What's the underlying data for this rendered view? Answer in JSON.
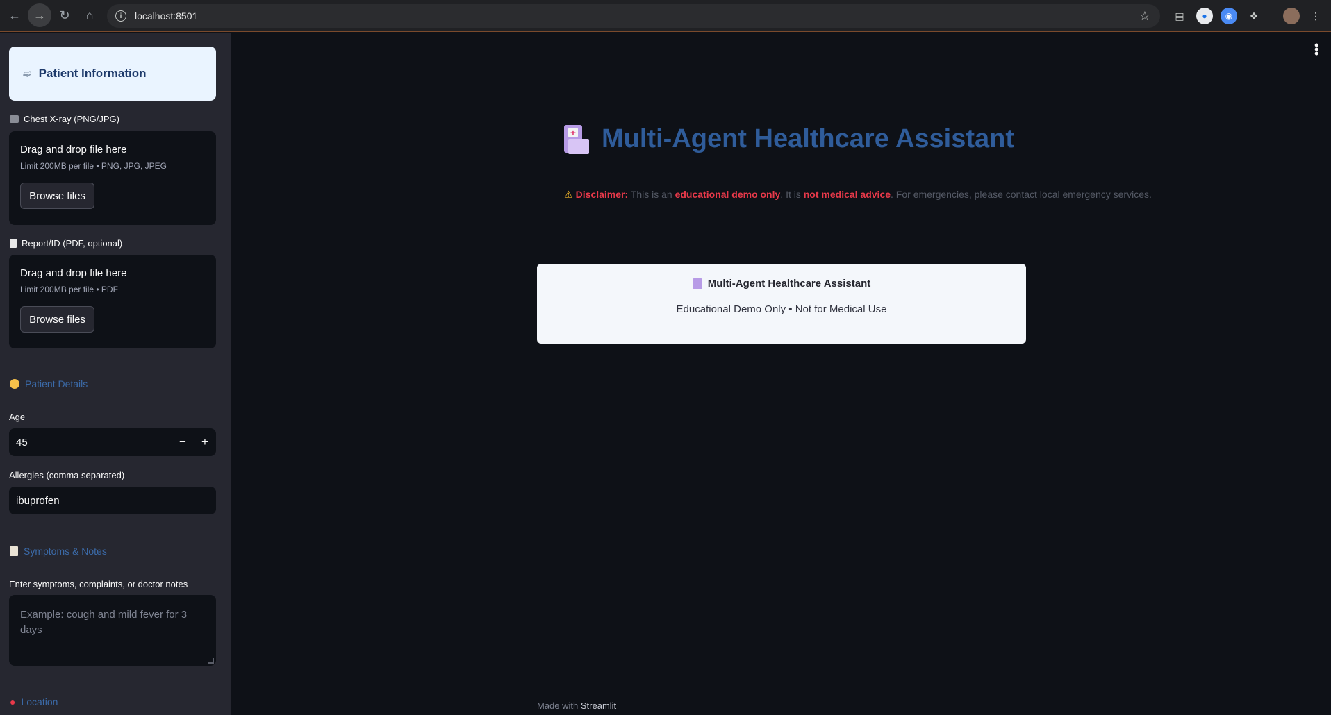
{
  "browser": {
    "url": "localhost:8501"
  },
  "sidebar": {
    "patient_card_title": "Patient Information",
    "chest_xray": {
      "label": "Chest X-ray (PNG/JPG)",
      "dropzone_title": "Drag and drop file here",
      "dropzone_limit": "Limit 200MB per file • PNG, JPG, JPEG",
      "button": "Browse files"
    },
    "report": {
      "label": "Report/ID (PDF, optional)",
      "dropzone_title": "Drag and drop file here",
      "dropzone_limit": "Limit 200MB per file • PDF",
      "button": "Browse files"
    },
    "patient_details": {
      "heading": "Patient Details",
      "age_label": "Age",
      "age_value": "45",
      "decrement": "−",
      "increment": "+",
      "allergies_label": "Allergies (comma separated)",
      "allergies_value": "ibuprofen"
    },
    "symptoms": {
      "heading": "Symptoms & Notes",
      "field_label": "Enter symptoms, complaints, or doctor notes",
      "placeholder": "Example: cough and mild fever for 3 days"
    },
    "location": {
      "heading": "Location"
    }
  },
  "main": {
    "title": "Multi-Agent Healthcare Assistant",
    "disclaimer": {
      "label": "Disclaimer:",
      "t1": " This is an ",
      "b1": "educational demo only",
      "t2": ". It is ",
      "b2": "not medical advice",
      "t3": ". For emergencies, please contact local emergency services."
    },
    "card": {
      "title": "Multi-Agent Healthcare Assistant",
      "subtitle": "Educational Demo Only • Not for Medical Use"
    },
    "footer": {
      "prefix": "Made with ",
      "brand": "Streamlit"
    }
  },
  "colors": {
    "sidebar_bg": "#262730",
    "main_bg": "#0e1117",
    "title_blue": "#2f5c9a",
    "disclaimer_red": "#e8394a"
  }
}
